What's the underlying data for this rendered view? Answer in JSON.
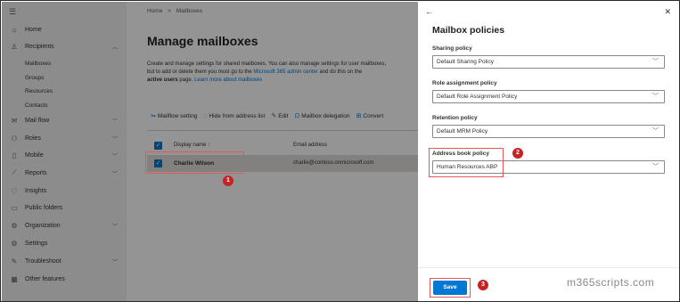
{
  "sidebar": {
    "items": [
      {
        "label": "Home",
        "icon": "home-icon"
      },
      {
        "label": "Recipients",
        "icon": "person-icon",
        "expanded": true
      },
      {
        "label": "Mail flow",
        "icon": "mail-icon"
      },
      {
        "label": "Roles",
        "icon": "roles-icon"
      },
      {
        "label": "Mobile",
        "icon": "mobile-icon"
      },
      {
        "label": "Reports",
        "icon": "reports-icon"
      },
      {
        "label": "Insights",
        "icon": "insights-icon"
      },
      {
        "label": "Public folders",
        "icon": "folder-icon"
      },
      {
        "label": "Organization",
        "icon": "organization-icon"
      },
      {
        "label": "Settings",
        "icon": "gear-icon"
      },
      {
        "label": "Troubleshoot",
        "icon": "wrench-icon"
      },
      {
        "label": "Other features",
        "icon": "grid-icon"
      }
    ],
    "sub_items": [
      "Mailboxes",
      "Groups",
      "Resources",
      "Contacts"
    ]
  },
  "main": {
    "breadcrumb": [
      "Home",
      ">",
      "Mailboxes"
    ],
    "title": "Manage mailboxes",
    "desc_1": "Create and manage settings for shared mailboxes. You can also manage settings for user mailboxes,",
    "desc_2a": "but to add or delete them you must go to the ",
    "desc_link1": "Microsoft 365 admin center",
    "desc_2b": " and do this on the",
    "desc_bold": "active users",
    "desc_3a": " page. ",
    "desc_link2": "Learn more about mailboxes",
    "toolbar": [
      "Mailflow setting",
      "Hide from address list",
      "Edit",
      "Mailbox delegation",
      "Convert"
    ],
    "columns": [
      "Display name ↑",
      "Email address"
    ],
    "row": {
      "name": "Charlie Wilson",
      "email": "charlie@contoso.onmicrosoft.com"
    }
  },
  "panel": {
    "title": "Mailbox policies",
    "fields": [
      {
        "label": "Sharing policy",
        "value": "Default Sharing Policy"
      },
      {
        "label": "Role assignment policy",
        "value": "Default Role Assignment Policy"
      },
      {
        "label": "Retention policy",
        "value": "Default MRM Policy"
      },
      {
        "label": "Address book policy",
        "value": "Human Resources ABP"
      }
    ],
    "save_label": "Save"
  },
  "markers": [
    "1",
    "2",
    "3"
  ],
  "watermark": "m365scripts.com",
  "colors": {
    "accent": "#0078d4",
    "marker": "#c52424",
    "highlight": "#e05a5a"
  }
}
